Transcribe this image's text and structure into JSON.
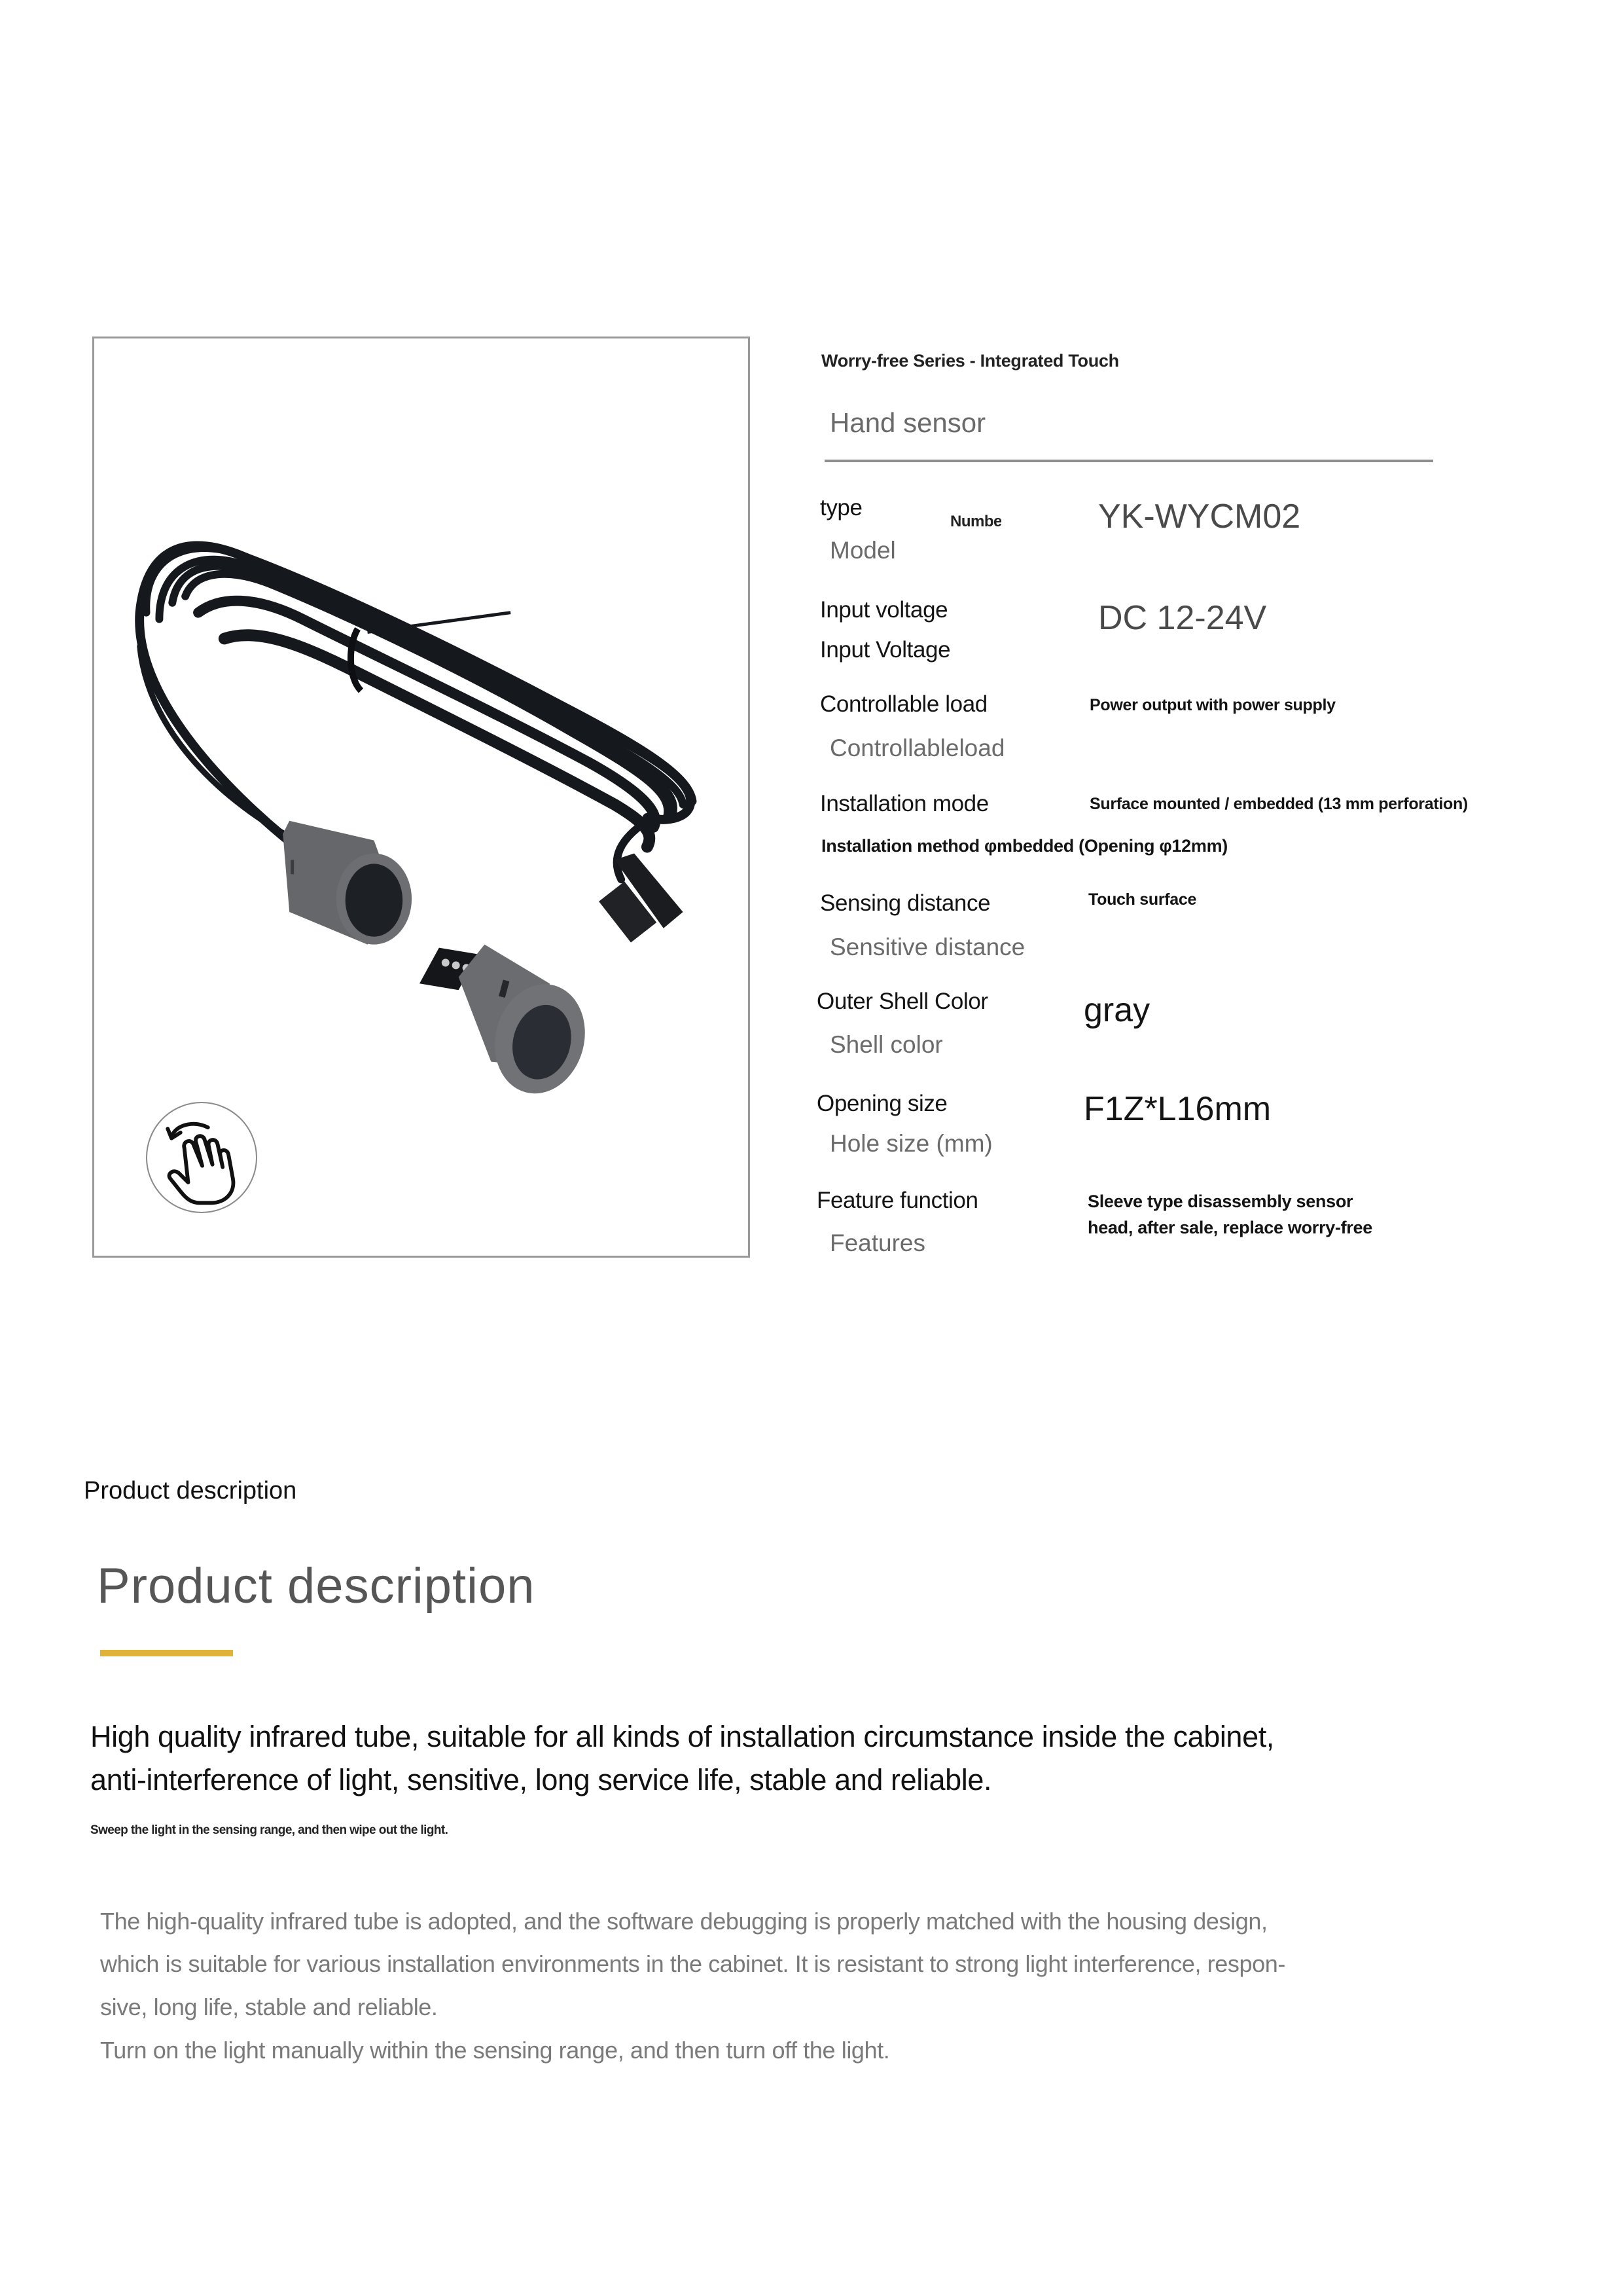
{
  "header": {
    "series": "Worry-free Series - Integrated Touch",
    "product_name": "Hand sensor"
  },
  "specs": [
    {
      "label": "type",
      "sublabel": "Model",
      "tag": "Numbe",
      "value": "YK-WYCM02"
    },
    {
      "label": "Input voltage",
      "sublabel": "Input Voltage",
      "value": "DC 12-24V"
    },
    {
      "label": "Controllable load",
      "sublabel": "Controllableload",
      "value": "Power output with power supply"
    },
    {
      "label": "Installation mode",
      "sublabel": "Installation method φmbedded (Opening φ12mm)",
      "value": "Surface mounted / embedded (13 mm perforation)"
    },
    {
      "label": "Sensing distance",
      "sublabel": "Sensitive distance",
      "value": "Touch surface"
    },
    {
      "label": "Outer Shell Color",
      "sublabel": "Shell color",
      "value": "gray"
    },
    {
      "label": "Opening size",
      "sublabel": "Hole size (mm)",
      "value": "F1Z*L16mm"
    },
    {
      "label": "Feature function",
      "sublabel": "Features",
      "value_lines": [
        "Sleeve type disassembly sensor",
        "head, after sale, replace worry-free"
      ]
    }
  ],
  "product_image": {
    "icon": "swipe-hand-icon",
    "shell_color": "#6a6c70",
    "cable_color": "#15181d"
  },
  "description": {
    "section_label": "Product description",
    "title": "Product description",
    "accent_color": "#e0b23c",
    "headline_lines": [
      "High quality infrared tube, suitable for all kinds of installation circumstance inside the cabinet,",
      "anti-interference of light, sensitive, long service life, stable and reliable."
    ],
    "caption": "Sweep the light in the sensing range, and then wipe out the light.",
    "body_lines": [
      "The high-quality infrared tube is adopted, and the software debugging is properly matched with the housing design,",
      "which is suitable for various installation environments in the cabinet. It is resistant to strong light interference, respon-",
      "sive, long life, stable and reliable.",
      "Turn on the light manually within the sensing range, and then turn off the light."
    ]
  }
}
